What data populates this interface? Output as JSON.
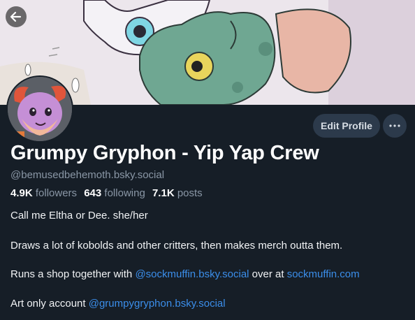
{
  "header": {
    "back_icon": "arrow-left-icon"
  },
  "profile": {
    "display_name": "Grumpy Gryphon - Yip Yap Crew",
    "handle": "@bemusedbehemoth.bsky.social",
    "stats": {
      "followers_count": "4.9K",
      "followers_label": "followers",
      "following_count": "643",
      "following_label": "following",
      "posts_count": "7.1K",
      "posts_label": "posts"
    }
  },
  "actions": {
    "edit_profile_label": "Edit Profile",
    "more_icon": "ellipsis-icon"
  },
  "bio": {
    "line1": "Call me Eltha or Dee. she/her",
    "line2": "Draws a lot of kobolds and other critters, then makes merch outta them.",
    "line3_prefix": "Runs a shop together with ",
    "line3_link1": "@sockmuffin.bsky.social",
    "line3_middle": " over at ",
    "line3_link2": "sockmuffin.com",
    "line4_prefix": "Art only account ",
    "line4_link": "@grumpygryphon.bsky.social"
  },
  "colors": {
    "background": "#161e27",
    "button_bg": "#2c3a4b",
    "link": "#3b8eea",
    "muted_text": "#8a97a6"
  }
}
